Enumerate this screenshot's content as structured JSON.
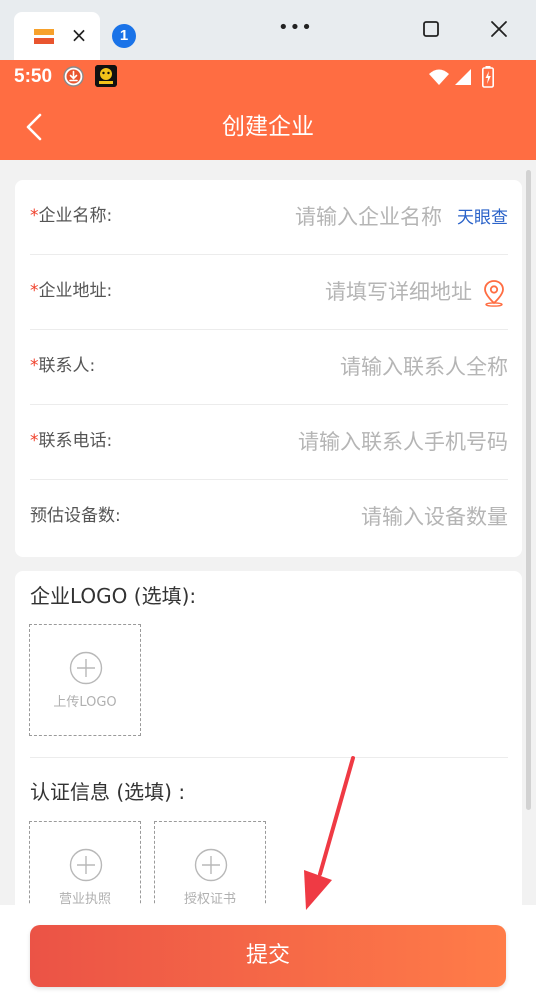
{
  "window": {
    "tab_favicon_icon": "app-logo-icon",
    "tab_close_glyph": "×",
    "badge_count": "1",
    "menu_glyph": "•••"
  },
  "status_bar": {
    "time": "5:50",
    "icons": [
      "download-icon",
      "app-notification-icon",
      "wifi-icon",
      "signal-icon",
      "battery-charging-icon"
    ]
  },
  "header": {
    "title": "创建企业",
    "back_icon": "chevron-left-icon"
  },
  "form": {
    "rows": [
      {
        "required_mark": "*",
        "label": "企业名称:",
        "placeholder": "请输入企业名称",
        "link": "天眼查"
      },
      {
        "required_mark": "*",
        "label": "企业地址:",
        "placeholder": "请填写详细地址",
        "icon": "location-pin-icon"
      },
      {
        "required_mark": "*",
        "label": "联系人:",
        "placeholder": "请输入联系人全称"
      },
      {
        "required_mark": "*",
        "label": "联系电话:",
        "placeholder": "请输入联系人手机号码"
      },
      {
        "label": "预估设备数:",
        "placeholder": "请输入设备数量"
      }
    ]
  },
  "uploads": {
    "logo_title": "企业LOGO (选填):",
    "logo_upload_label": "上传LOGO",
    "cert_title": "认证信息 (选填) :",
    "cert_items": [
      "营业执照",
      "授权证书"
    ]
  },
  "footer": {
    "submit_label": "提交"
  },
  "colors": {
    "brand": "#ff6d42",
    "required": "#ef3f2a",
    "link": "#2b63c9",
    "annotation_arrow": "#ef3a44"
  }
}
